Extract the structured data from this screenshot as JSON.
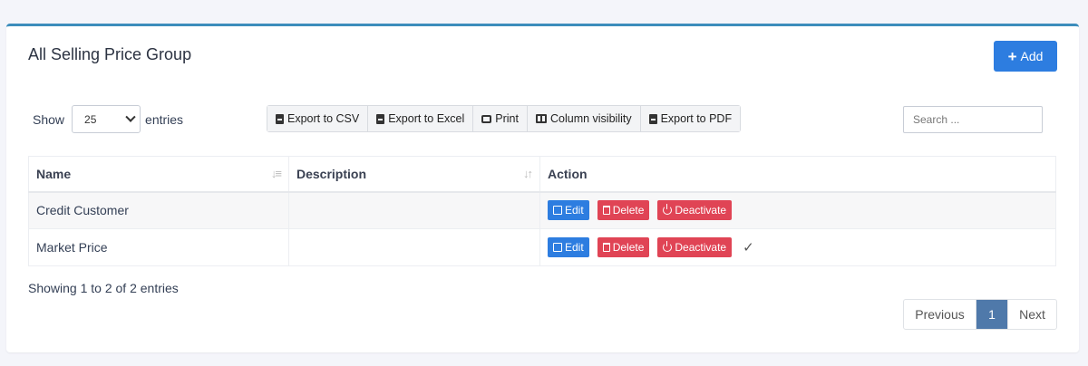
{
  "card": {
    "title": "All Selling Price Group",
    "add_label": "Add"
  },
  "length": {
    "show_label": "Show",
    "entries_label": "entries",
    "selected": "25"
  },
  "exports": [
    {
      "label": "Export to CSV",
      "icon": "file-csv-icon"
    },
    {
      "label": "Export to Excel",
      "icon": "file-excel-icon"
    },
    {
      "label": "Print",
      "icon": "print-icon"
    },
    {
      "label": "Column visibility",
      "icon": "columns-icon"
    },
    {
      "label": "Export to PDF",
      "icon": "file-pdf-icon"
    }
  ],
  "search": {
    "placeholder": "Search ..."
  },
  "table": {
    "headers": [
      "Name",
      "Description",
      "Action"
    ],
    "rows": [
      {
        "name": "Credit Customer",
        "description": "",
        "checked": false
      },
      {
        "name": "Market Price",
        "description": "",
        "checked": true
      }
    ],
    "actions": {
      "edit": "Edit",
      "delete": "Delete",
      "deactivate": "Deactivate"
    }
  },
  "info": "Showing 1 to 2 of 2 entries",
  "pagination": {
    "previous": "Previous",
    "current": "1",
    "next": "Next"
  },
  "colors": {
    "accent": "#2d7de0",
    "danger": "#e04455",
    "active_page": "#4f79aa",
    "card_border": "#3c8dbc"
  }
}
